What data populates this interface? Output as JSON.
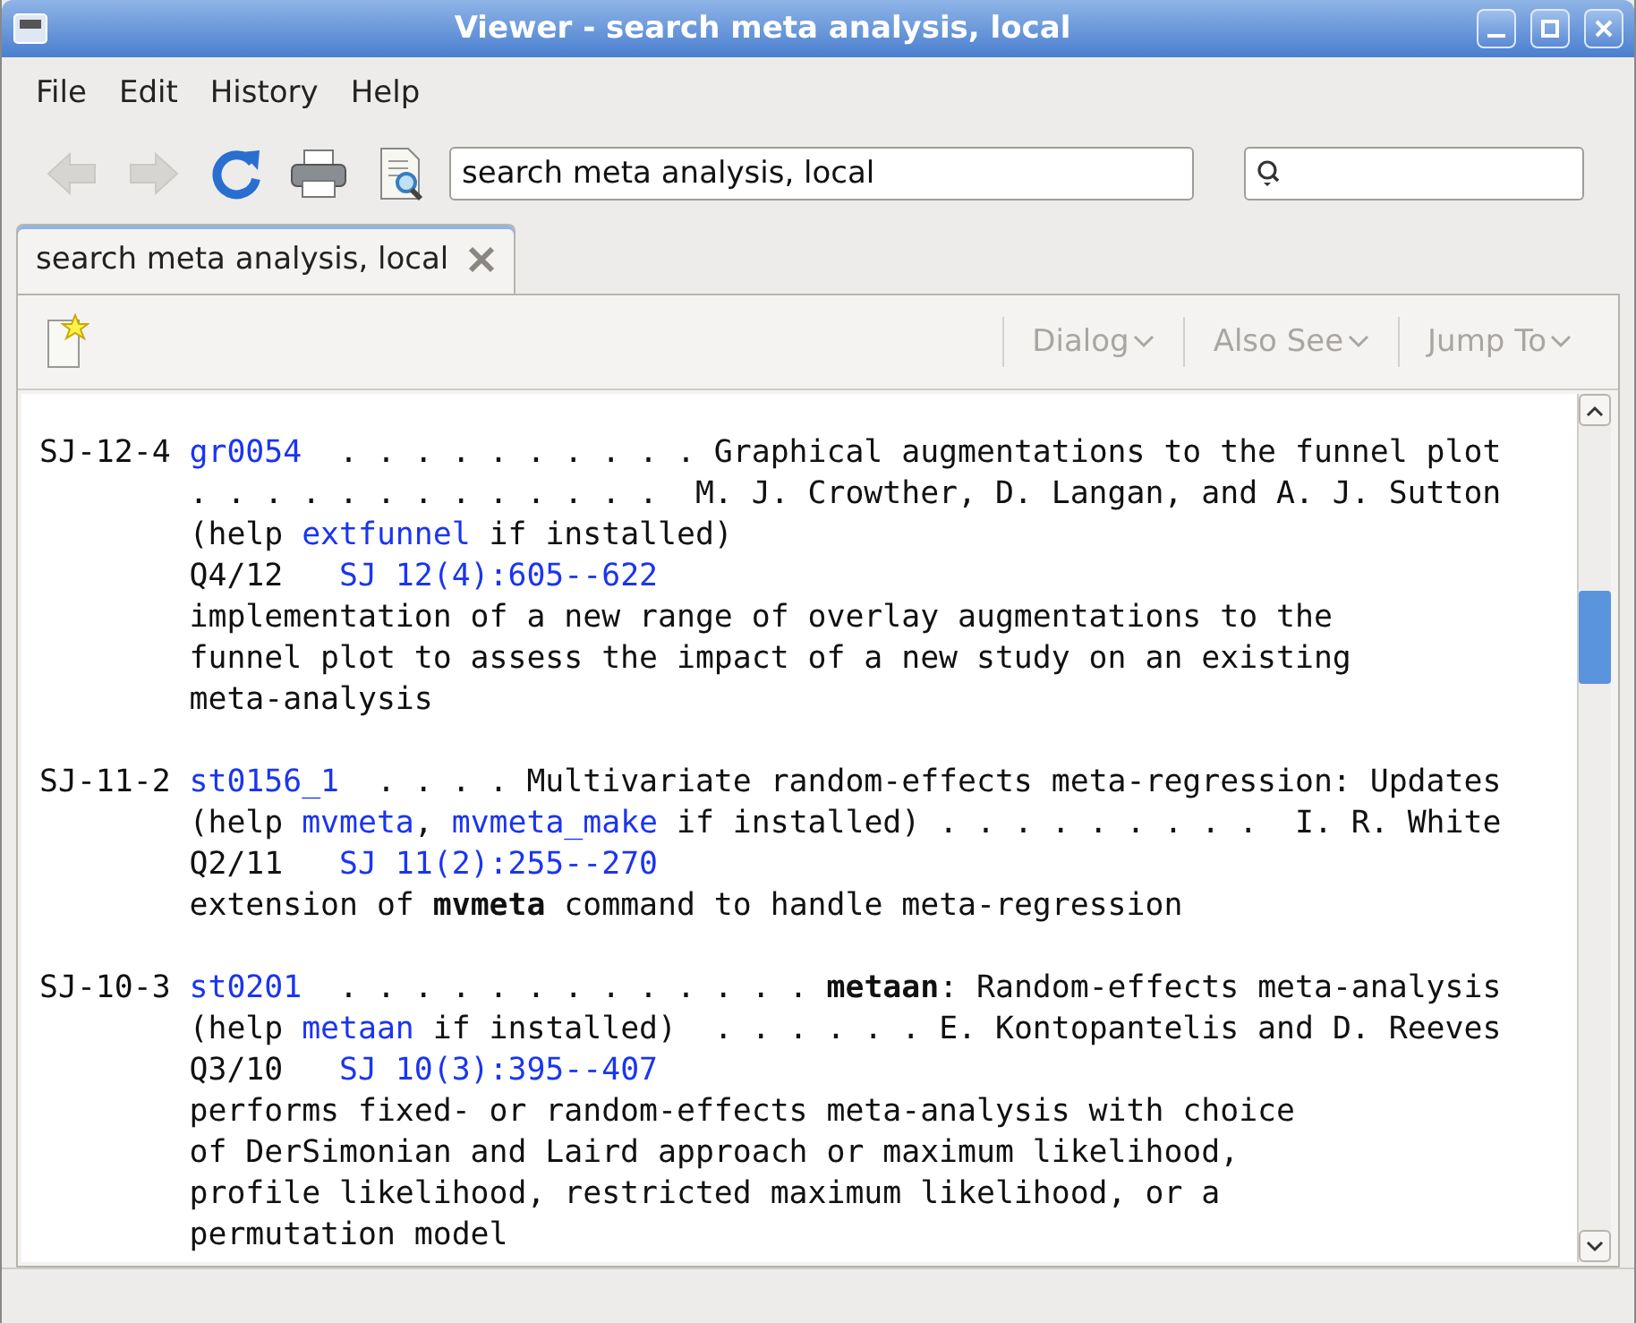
{
  "window": {
    "title": "Viewer - search meta analysis, local"
  },
  "menu": [
    {
      "label": "File"
    },
    {
      "label": "Edit"
    },
    {
      "label": "History"
    },
    {
      "label": "Help"
    }
  ],
  "toolbar": {
    "buttons": [
      {
        "kind": "back",
        "disabled": true
      },
      {
        "kind": "forward",
        "disabled": true
      },
      {
        "kind": "refresh",
        "disabled": false
      },
      {
        "kind": "print",
        "disabled": false
      },
      {
        "kind": "find",
        "disabled": false
      }
    ],
    "address": {
      "value": "search meta analysis, local"
    }
  },
  "tabs": [
    {
      "label": "search meta analysis, local",
      "selected": true
    }
  ],
  "viewer_toolbar": {
    "menus": [
      {
        "label": "Dialog",
        "disabled": true
      },
      {
        "label": "Also See",
        "disabled": true
      },
      {
        "label": "Jump To",
        "disabled": true
      }
    ]
  },
  "entries": [
    {
      "id": "SJ-12-4",
      "lines": [
        [
          {
            "kind": "link",
            "text": "gr0054"
          },
          {
            "kind": "text",
            "text": "  . . . . . . . . . . Graphical augmentations to the funnel plot"
          }
        ],
        [
          {
            "kind": "text",
            "text": ". . . . . . . . . . . . .  M. J. Crowther, D. Langan, and A. J. Sutton"
          }
        ],
        [
          {
            "kind": "text",
            "text": "(help "
          },
          {
            "kind": "link",
            "text": "extfunnel"
          },
          {
            "kind": "text",
            "text": " if installed)"
          }
        ],
        [
          {
            "kind": "text",
            "text": "Q4/12   "
          },
          {
            "kind": "link",
            "text": "SJ 12(4):605--622"
          }
        ],
        [
          {
            "kind": "text",
            "text": "implementation of a new range of overlay augmentations to the"
          }
        ],
        [
          {
            "kind": "text",
            "text": "funnel plot to assess the impact of a new study on an existing"
          }
        ],
        [
          {
            "kind": "text",
            "text": "meta-analysis"
          }
        ]
      ]
    },
    {
      "id": "SJ-11-2",
      "lines": [
        [
          {
            "kind": "link",
            "text": "st0156_1"
          },
          {
            "kind": "text",
            "text": "  . . . . Multivariate random-effects meta-regression: Updates"
          }
        ],
        [
          {
            "kind": "text",
            "text": "(help "
          },
          {
            "kind": "link",
            "text": "mvmeta"
          },
          {
            "kind": "text",
            "text": ", "
          },
          {
            "kind": "link",
            "text": "mvmeta_make"
          },
          {
            "kind": "text",
            "text": " if installed) . . . . . . . . .  I. R. White"
          }
        ],
        [
          {
            "kind": "text",
            "text": "Q2/11   "
          },
          {
            "kind": "link",
            "text": "SJ 11(2):255--270"
          }
        ],
        [
          {
            "kind": "text",
            "text": "extension of "
          },
          {
            "kind": "bold",
            "text": "mvmeta"
          },
          {
            "kind": "text",
            "text": " command to handle meta-regression"
          }
        ]
      ]
    },
    {
      "id": "SJ-10-3",
      "lines": [
        [
          {
            "kind": "link",
            "text": "st0201"
          },
          {
            "kind": "text",
            "text": "  . . . . . . . . . . . . . "
          },
          {
            "kind": "bold",
            "text": "metaan"
          },
          {
            "kind": "text",
            "text": ": Random-effects meta-analysis"
          }
        ],
        [
          {
            "kind": "text",
            "text": "(help "
          },
          {
            "kind": "link",
            "text": "metaan"
          },
          {
            "kind": "text",
            "text": " if installed)  . . . . . . E. Kontopantelis and D. Reeves"
          }
        ],
        [
          {
            "kind": "text",
            "text": "Q3/10   "
          },
          {
            "kind": "link",
            "text": "SJ 10(3):395--407"
          }
        ],
        [
          {
            "kind": "text",
            "text": "performs fixed- or random-effects meta-analysis with choice"
          }
        ],
        [
          {
            "kind": "text",
            "text": "of DerSimonian and Laird approach or maximum likelihood,"
          }
        ],
        [
          {
            "kind": "text",
            "text": "profile likelihood, restricted maximum likelihood, or a"
          }
        ],
        [
          {
            "kind": "text",
            "text": "permutation model"
          }
        ]
      ]
    }
  ]
}
